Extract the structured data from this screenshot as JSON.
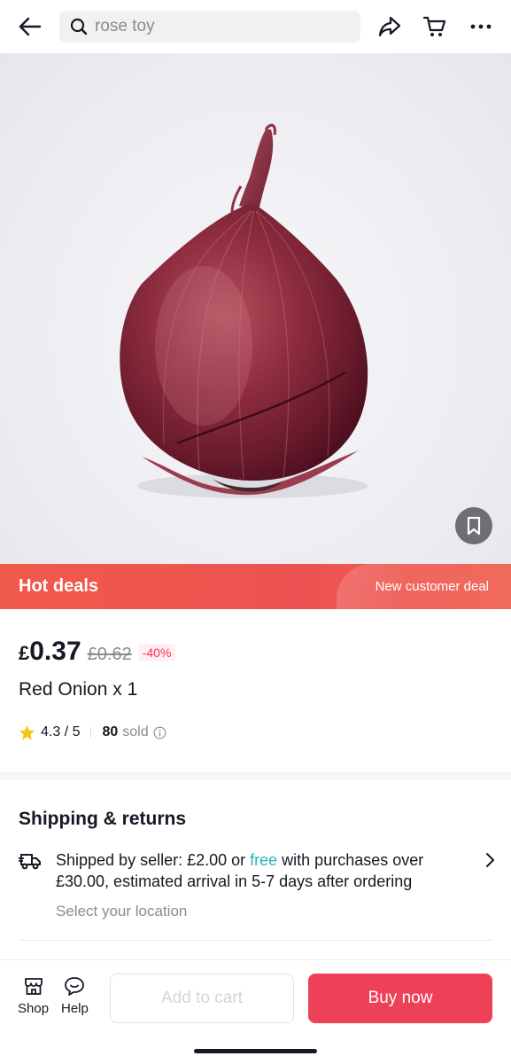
{
  "search": {
    "placeholder": "rose toy"
  },
  "icons": {
    "back": "arrow-left-icon",
    "search": "search-icon",
    "share": "share-icon",
    "cart": "cart-icon",
    "more": "more-icon",
    "save": "bookmark-icon",
    "star": "star-icon",
    "info": "info-icon",
    "truck": "truck-icon",
    "chevron": "chevron-right-icon",
    "shop": "shop-icon",
    "help": "help-icon"
  },
  "deals": {
    "title": "Hot deals",
    "subtitle": "New customer deal"
  },
  "product": {
    "currency": "£",
    "price": "0.37",
    "original_price": "£0.62",
    "discount": "-40%",
    "title": "Red Onion x 1",
    "rating": "4.3 / 5",
    "sold_count": "80",
    "sold_label": "sold"
  },
  "shipping": {
    "title": "Shipping & returns",
    "text_before": "Shipped by seller: £2.00 or ",
    "free_word": "free",
    "text_after": " with purchases over £30.00, estimated arrival in 5-7 days after ordering",
    "location": "Select your location"
  },
  "bottom": {
    "shop_label": "Shop",
    "help_label": "Help",
    "add_to_cart": "Add to cart",
    "buy_now": "Buy now"
  },
  "colors": {
    "accent": "#ee4057",
    "deals_banner": "#ef5550",
    "free_text": "#28b3c1",
    "discount": "#fe2c55",
    "star": "#f5c518"
  }
}
